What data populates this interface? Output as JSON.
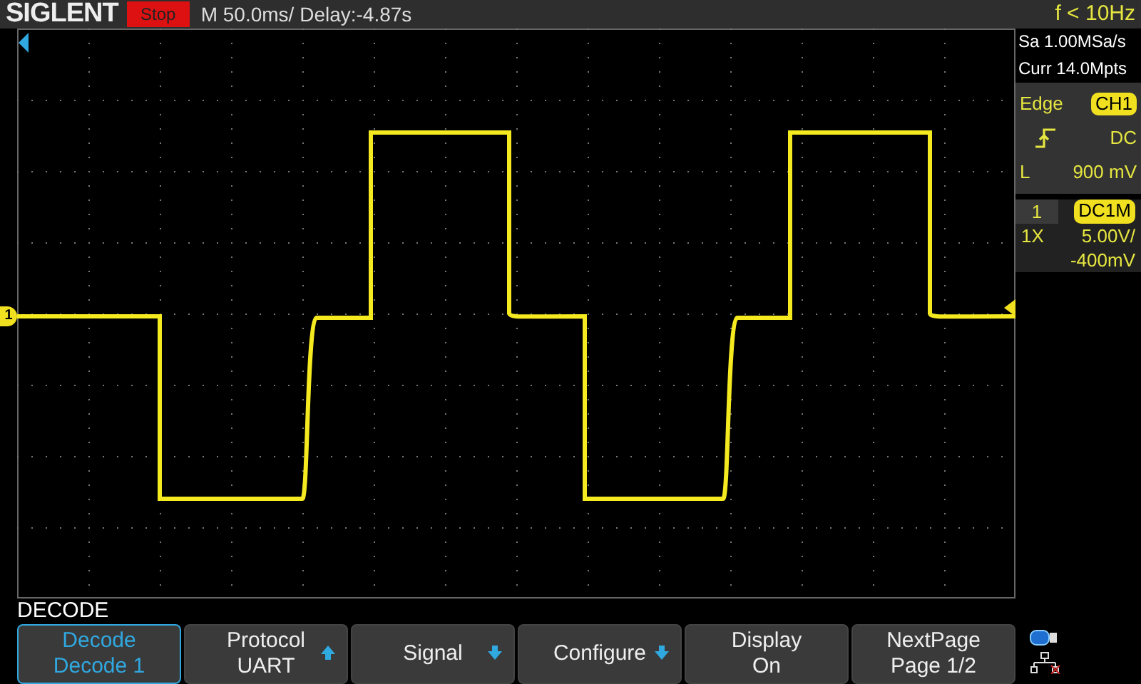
{
  "top_bar": {
    "brand": "SIGLENT",
    "run_state": "Stop",
    "timebase": "M 50.0ms/ Delay:-4.87s",
    "frequency": "f < 10Hz"
  },
  "acquisition": {
    "sample_rate": "Sa 1.00MSa/s",
    "memory": "Curr 14.0Mpts"
  },
  "trigger": {
    "type": "Edge",
    "source": "CH1",
    "coupling": "DC",
    "level_label": "L",
    "level": "900 mV"
  },
  "channel": {
    "number": "1",
    "coupling": "DC1M",
    "probe": "1X",
    "scale": "5.00V/",
    "offset": "-400mV"
  },
  "trace_marker": "1",
  "menu_title": "DECODE",
  "softkeys": [
    {
      "kind": "plain",
      "label": "Decode",
      "value": "Decode 1",
      "selected": true
    },
    {
      "kind": "up",
      "label": "Protocol",
      "value": "UART",
      "selected": false
    },
    {
      "kind": "down",
      "label": "Signal",
      "selected": false
    },
    {
      "kind": "down",
      "label": "Configure",
      "selected": false
    },
    {
      "kind": "plain",
      "label": "Display",
      "value": "On",
      "selected": false
    },
    {
      "kind": "plain",
      "label": "NextPage",
      "value": "Page 1/2",
      "selected": false
    }
  ]
}
